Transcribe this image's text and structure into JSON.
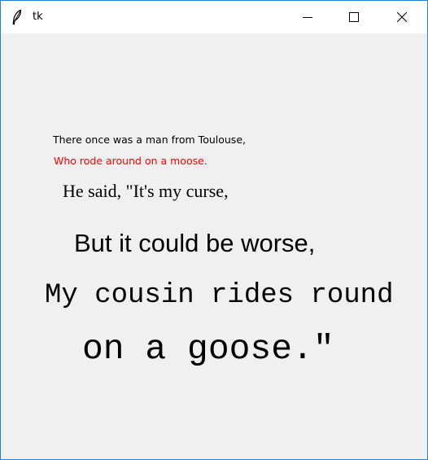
{
  "window": {
    "title": "tk",
    "border_color": "#1883d7",
    "app_icon": "feather-icon",
    "controls": [
      "minimize-icon",
      "maximize-icon",
      "close-icon"
    ]
  },
  "poem": {
    "lines": [
      {
        "text": "There once was a man from Toulouse,",
        "color": "#000000"
      },
      {
        "text": "Who rode around on a moose.",
        "color": "#ff0000"
      },
      {
        "text": "He said, \"It's my curse,",
        "color": "#000000"
      },
      {
        "text": "But it could be worse,",
        "color": "#000000"
      },
      {
        "text": "My cousin rides round",
        "color": "#000000"
      },
      {
        "text": "on a goose.\"",
        "color": "#000000"
      }
    ]
  }
}
